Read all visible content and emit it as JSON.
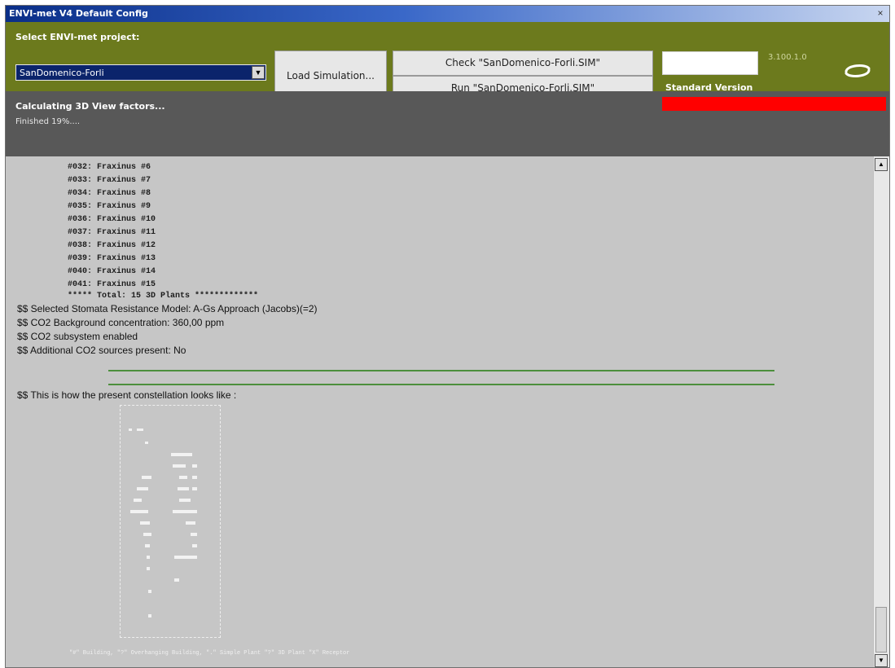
{
  "window": {
    "title": "ENVI-met V4 Default Config",
    "close_glyph": "×"
  },
  "project": {
    "label": "Select ENVI-met project:",
    "selected": "SanDomenico-Forli"
  },
  "buttons": {
    "load": "Load Simulation...",
    "check": "Check \"SanDomenico-Forli.SIM\"",
    "run": "Run \"SanDomenico-Forli.SIM\""
  },
  "version": {
    "edition": "Standard Version",
    "number": "3.100.1.0"
  },
  "status": {
    "task": "Calculating 3D View factors...",
    "progress_text": "Finished 19%....",
    "progress_fraction": 0.19
  },
  "log": {
    "plants": [
      "#032: Fraxinus #6",
      "#033: Fraxinus #7",
      "#034: Fraxinus #8",
      "#035: Fraxinus #9",
      "#036: Fraxinus #10",
      "#037: Fraxinus #11",
      "#038: Fraxinus #12",
      "#039: Fraxinus #13",
      "#040: Fraxinus #14",
      "#041: Fraxinus #15"
    ],
    "total": "***** Total: 15 3D Plants *************",
    "messages": [
      "$$ Selected Stomata Resistance Model: A-Gs Approach (Jacobs)(=2)",
      "$$ CO2 Background concentration: 360,00 ppm",
      "$$ CO2 subsystem enabled",
      "$$ Additional CO2 sources present: No"
    ],
    "constellation": "$$ This is how the present constellation looks like :",
    "legend": "\"#\" Building, \"?\" Overhanging Building, \".\" Simple Plant \"?\" 3D Plant \"X\" Receptor"
  },
  "colors": {
    "topbar": "#6c7a1d",
    "statusbar": "#585858",
    "progress": "#ff0000",
    "log_bg": "#c6c6c6"
  },
  "icons": {
    "logo": "envimet-swirl-icon",
    "dropdown": "chevron-down-icon",
    "scroll_up": "arrow-up-icon",
    "scroll_down": "arrow-down-icon"
  }
}
